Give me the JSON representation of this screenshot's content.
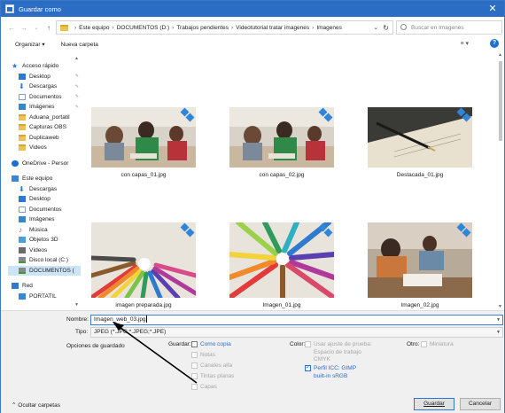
{
  "window": {
    "title": "Guardar como",
    "close_glyph": "✕"
  },
  "nav": {
    "back": "←",
    "forward": "→",
    "recent": "⌄",
    "up": "↑",
    "breadcrumb": [
      "Este equipo",
      "DOCUMENTOS (D:)",
      "Trabajos pendientes",
      "Videotutorial tratar imagenes",
      "Imagenes"
    ],
    "separator": "›",
    "search_placeholder": "Buscar en Imagenes"
  },
  "toolbar": {
    "organize": "Organizar ▾",
    "new_folder": "Nueva carpeta",
    "view_glyph": "≡ ▾",
    "help_glyph": "?"
  },
  "sidebar": {
    "quick_access": "Acceso rápido",
    "quick_items": [
      {
        "label": "Desktop",
        "icon": "desktop-icon",
        "pinned": true
      },
      {
        "label": "Descargas",
        "icon": "downloads-icon",
        "pinned": true
      },
      {
        "label": "Documentos",
        "icon": "documents-icon",
        "pinned": true
      },
      {
        "label": "Imágenes",
        "icon": "pictures-icon",
        "pinned": true
      },
      {
        "label": "Aduana_portatil",
        "icon": "folder-icon"
      },
      {
        "label": "Capturas OBS",
        "icon": "folder-icon"
      },
      {
        "label": "Duplicaweb",
        "icon": "folder-icon"
      },
      {
        "label": "Videos",
        "icon": "folder-icon"
      }
    ],
    "onedrive": "OneDrive - Persor",
    "this_pc": "Este equipo",
    "pc_items": [
      {
        "label": "Descargas",
        "icon": "downloads-icon"
      },
      {
        "label": "Desktop",
        "icon": "desktop-icon"
      },
      {
        "label": "Documentos",
        "icon": "documents-icon"
      },
      {
        "label": "Imágenes",
        "icon": "pictures-icon"
      },
      {
        "label": "Música",
        "icon": "music-icon"
      },
      {
        "label": "Objetos 3D",
        "icon": "3d-objects-icon"
      },
      {
        "label": "Vídeos",
        "icon": "videos-icon"
      },
      {
        "label": "Disco local (C:)",
        "icon": "drive-icon"
      },
      {
        "label": "DOCUMENTOS (",
        "icon": "drive-icon",
        "selected": true
      }
    ],
    "network": "Red",
    "network_items": [
      {
        "label": "PORTATIL",
        "icon": "computer-icon"
      }
    ]
  },
  "files": [
    {
      "name": "con capas_01.jpg",
      "thumb": "children-classroom"
    },
    {
      "name": "con capas_02.jpg",
      "thumb": "children-classroom"
    },
    {
      "name": "Destacada_01.jpg",
      "thumb": "pen-and-letter"
    },
    {
      "name": "imagen preparada.jpg",
      "thumb": "colored-pencils"
    },
    {
      "name": "Imagen_01.jpg",
      "thumb": "colored-pencils"
    },
    {
      "name": "Imagen_02.jpg",
      "thumb": "children-writing"
    }
  ],
  "form": {
    "filename_label": "Nombre:",
    "filename_value": "Imagen_web_03.jpg",
    "type_label": "Tipo:",
    "type_value": "JPEG (*.JPG;*.JPEG;*.JPE)",
    "save_options": "Opciones de guardado",
    "save_label": "Guardar:",
    "save_as_copy": "Como copia",
    "notes": "Notas",
    "alpha": "Canales alfa",
    "spot": "Tintas planas",
    "layers": "Capas",
    "color_label": "Color:",
    "proof_setup": "Usar ajuste de prueba:",
    "proof_line2": "Espacio de trabajo",
    "proof_line3": "CMYK",
    "icc_profile": "Perfil ICC: GIMP",
    "icc_line2": "built-in sRGB",
    "other_label": "Otro:",
    "thumbnail": "Miniatura"
  },
  "footer": {
    "hide_folders": "Ocultar carpetas",
    "save_button": "Guardar",
    "cancel_button": "Cancelar"
  }
}
